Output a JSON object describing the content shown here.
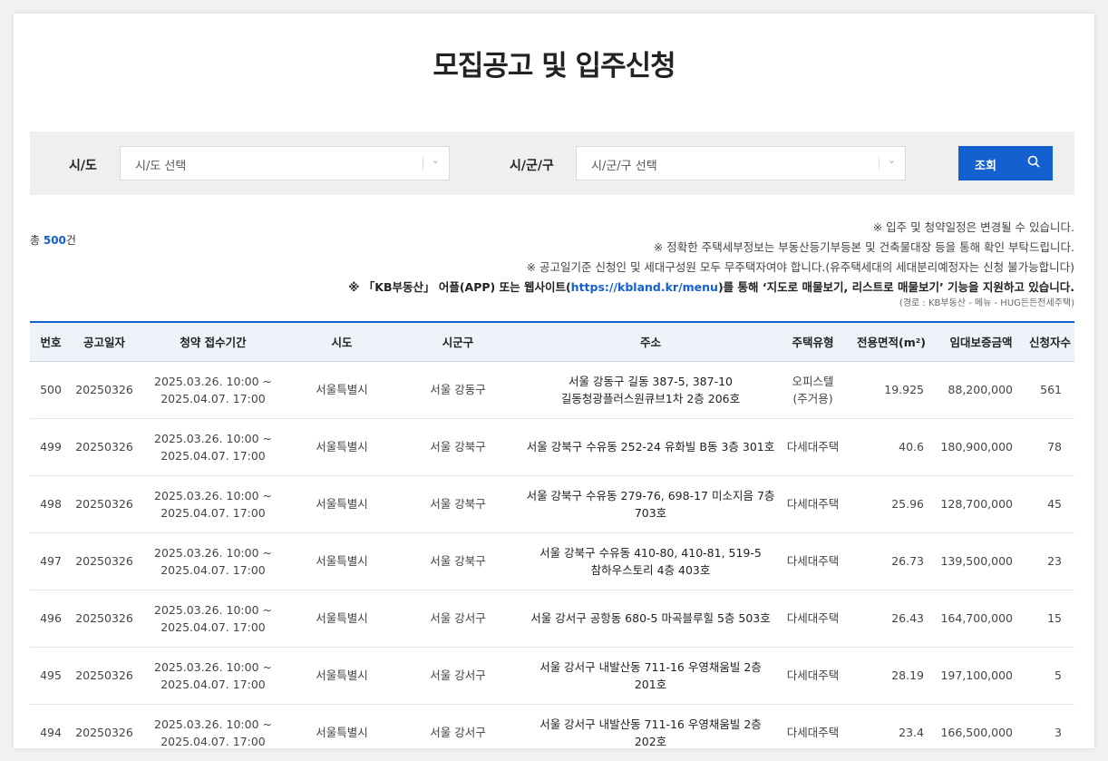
{
  "page": {
    "title": "모집공고 및 입주신청"
  },
  "filters": {
    "sido_label": "시/도",
    "sido_placeholder": "시/도 선택",
    "sigungu_label": "시/군/구",
    "sigungu_placeholder": "시/군/구 선택",
    "search_label": "조회",
    "search_icon": "search-icon"
  },
  "summary": {
    "prefix": "총 ",
    "count": "500",
    "suffix": "건"
  },
  "notices": [
    "※ 입주 및 청약일정은 변경될 수 있습니다.",
    "※ 정확한 주택세부정보는 부동산등기부등본 및 건축물대장 등을 통해 확인 부탁드립니다.",
    "※ 공고일기준 신청인 및 세대구성원 모두 무주택자여야 합니다.(유주택세대의 세대분리예정자는 신청 불가능합니다)"
  ],
  "notice_strong": {
    "before": "※ 「KB부동산」 어플(APP) 또는 웹사이트(",
    "link": "https://kbland.kr/menu",
    "after": ")를 통해 ‘지도로 매물보기, 리스트로 매물보기’ 기능을 지원하고 있습니다.",
    "path": "(경로 : KB부동산 - 메뉴 - HUG든든전세주택)"
  },
  "table": {
    "headers": [
      "번호",
      "공고일자",
      "청약 접수기간",
      "시도",
      "시군구",
      "주소",
      "주택유형",
      "전용면적(m²)",
      "임대보증금액",
      "신청자수"
    ],
    "rows": [
      {
        "no": "500",
        "date": "20250326",
        "period1": "2025.03.26. 10:00 ~",
        "period2": "2025.04.07. 17:00",
        "sido": "서울특별시",
        "sigungu": "서울 강동구",
        "addr1": "서울 강동구 길동 387-5, 387-10",
        "addr2": "길동청광플러스원큐브1차 2층 206호",
        "type1": "오피스텔",
        "type2": "(주거용)",
        "area": "19.925",
        "deposit": "88,200,000",
        "applicants": "561"
      },
      {
        "no": "499",
        "date": "20250326",
        "period1": "2025.03.26. 10:00 ~",
        "period2": "2025.04.07. 17:00",
        "sido": "서울특별시",
        "sigungu": "서울 강북구",
        "addr1": "서울 강북구 수유동 252-24 유화빌 B동 3층 301호",
        "addr2": "",
        "type1": "다세대주택",
        "type2": "",
        "area": "40.6",
        "deposit": "180,900,000",
        "applicants": "78"
      },
      {
        "no": "498",
        "date": "20250326",
        "period1": "2025.03.26. 10:00 ~",
        "period2": "2025.04.07. 17:00",
        "sido": "서울특별시",
        "sigungu": "서울 강북구",
        "addr1": "서울 강북구 수유동 279-76, 698-17 미소지음 7층",
        "addr2": "703호",
        "type1": "다세대주택",
        "type2": "",
        "area": "25.96",
        "deposit": "128,700,000",
        "applicants": "45"
      },
      {
        "no": "497",
        "date": "20250326",
        "period1": "2025.03.26. 10:00 ~",
        "period2": "2025.04.07. 17:00",
        "sido": "서울특별시",
        "sigungu": "서울 강북구",
        "addr1": "서울 강북구 수유동 410-80, 410-81, 519-5",
        "addr2": "참하우스토리 4층 403호",
        "type1": "다세대주택",
        "type2": "",
        "area": "26.73",
        "deposit": "139,500,000",
        "applicants": "23"
      },
      {
        "no": "496",
        "date": "20250326",
        "period1": "2025.03.26. 10:00 ~",
        "period2": "2025.04.07. 17:00",
        "sido": "서울특별시",
        "sigungu": "서울 강서구",
        "addr1": "서울 강서구 공항동 680-5 마곡블루힐 5층 503호",
        "addr2": "",
        "type1": "다세대주택",
        "type2": "",
        "area": "26.43",
        "deposit": "164,700,000",
        "applicants": "15"
      },
      {
        "no": "495",
        "date": "20250326",
        "period1": "2025.03.26. 10:00 ~",
        "period2": "2025.04.07. 17:00",
        "sido": "서울특별시",
        "sigungu": "서울 강서구",
        "addr1": "서울 강서구 내발산동 711-16 우영채움빌 2층",
        "addr2": "201호",
        "type1": "다세대주택",
        "type2": "",
        "area": "28.19",
        "deposit": "197,100,000",
        "applicants": "5"
      },
      {
        "no": "494",
        "date": "20250326",
        "period1": "2025.03.26. 10:00 ~",
        "period2": "2025.04.07. 17:00",
        "sido": "서울특별시",
        "sigungu": "서울 강서구",
        "addr1": "서울 강서구 내발산동 711-16 우영채움빌 2층",
        "addr2": "202호",
        "type1": "다세대주택",
        "type2": "",
        "area": "23.4",
        "deposit": "166,500,000",
        "applicants": "3"
      }
    ]
  }
}
